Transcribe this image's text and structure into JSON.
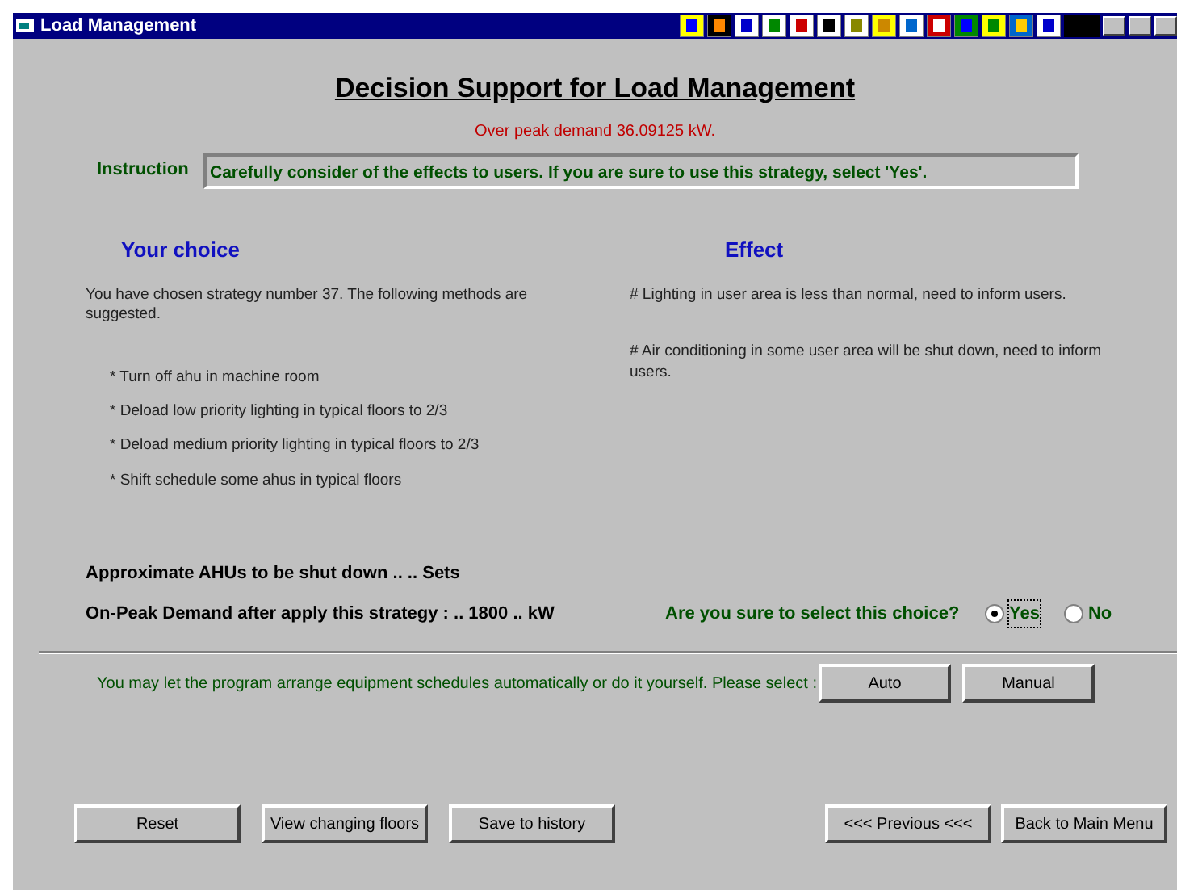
{
  "window": {
    "title": "Load Management"
  },
  "heading": "Decision Support for Load Management",
  "over_peak": "Over peak demand 36.09125 kW.",
  "instruction": {
    "label": "Instruction",
    "value": "Carefully consider of the effects to users. If you are sure to use this strategy, select 'Yes'."
  },
  "choice": {
    "heading": "Your choice",
    "intro": "You have chosen strategy number 37. The following methods are suggested.",
    "methods": [
      "* Turn off ahu in machine room",
      "* Deload low priority lighting in typical floors to 2/3",
      "* Deload medium priority lighting in typical floors to 2/3",
      "* Shift schedule some ahus in typical floors"
    ]
  },
  "effect": {
    "heading": "Effect",
    "items": [
      "# Lighting in user area is less than normal, need to inform users.",
      "# Air conditioning in some user area will be shut down, need to inform users."
    ]
  },
  "ahus_line": "Approximate AHUs to be shut down ..  .. Sets",
  "demand_line": "On-Peak Demand after apply this strategy : .. 1800 .. kW",
  "confirm": {
    "question": "Are you sure to select this choice?",
    "options": [
      {
        "label": "Yes",
        "selected": true
      },
      {
        "label": "No",
        "selected": false
      }
    ]
  },
  "schedule": {
    "prompt": "You may let the program arrange equipment schedules automatically or do it yourself.  Please select :",
    "buttons": [
      "Auto",
      "Manual"
    ]
  },
  "left_buttons": [
    "Reset",
    "View changing floors",
    "Save to history"
  ],
  "right_buttons": [
    "<<< Previous <<<",
    "Back to Main Menu"
  ]
}
